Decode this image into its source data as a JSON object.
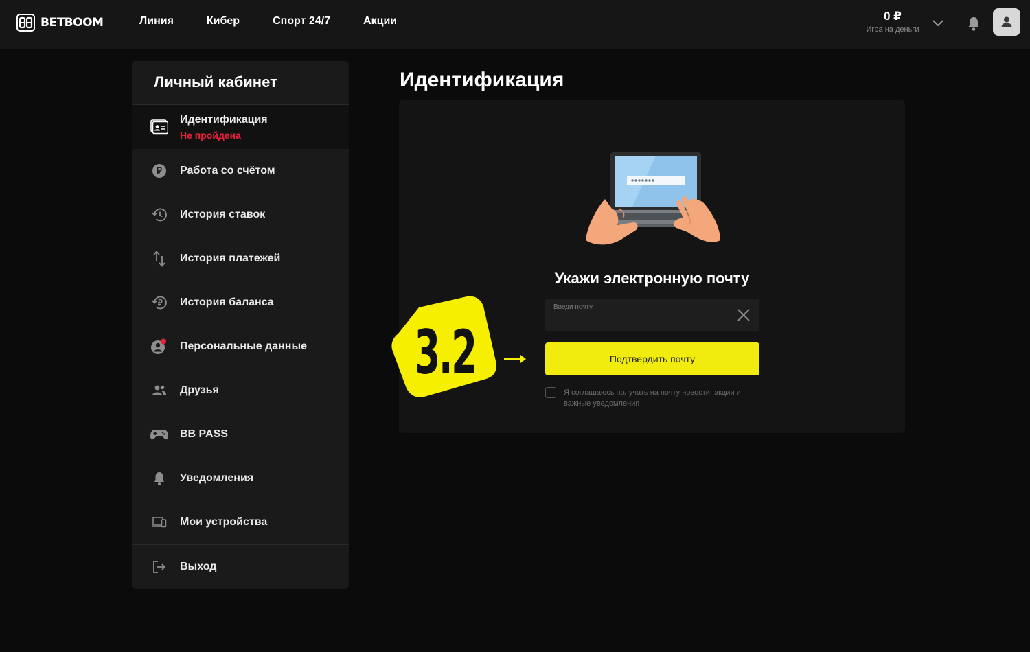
{
  "header": {
    "logo_text": "BETBOOM",
    "nav": [
      "Линия",
      "Кибер",
      "Спорт 24/7",
      "Акции"
    ],
    "balance_amount": "0 ₽",
    "balance_label": "Игра на деньги"
  },
  "sidebar": {
    "title": "Личный кабинет",
    "items": [
      {
        "label": "Идентификация",
        "sub": "Не пройдена",
        "icon": "id-card-icon"
      },
      {
        "label": "Работа со счётом",
        "icon": "ruble-coin-icon"
      },
      {
        "label": "История ставок",
        "icon": "history-icon"
      },
      {
        "label": "История платежей",
        "icon": "transfer-arrows-icon"
      },
      {
        "label": "История баланса",
        "icon": "balance-history-icon"
      },
      {
        "label": "Персональные данные",
        "icon": "user-alert-icon"
      },
      {
        "label": "Друзья",
        "icon": "friends-icon"
      },
      {
        "label": "BB PASS",
        "icon": "gamepad-icon"
      },
      {
        "label": "Уведомления",
        "icon": "bell-icon"
      },
      {
        "label": "Мои устройства",
        "icon": "devices-icon"
      }
    ],
    "logout": {
      "label": "Выход",
      "icon": "logout-icon"
    }
  },
  "main": {
    "title": "Идентификация",
    "heading": "Укажи электронную почту",
    "email_placeholder": "Введи почту",
    "email_value": "",
    "confirm_label": "Подтвердить почту",
    "consent_text": "Я соглашаюсь получать на почту новости, акции и важные уведомления",
    "consent_checked": false
  },
  "overlay": {
    "step_badge": "3.2"
  },
  "colors": {
    "accent_yellow": "#f2ec0e",
    "error_red": "#e8213a",
    "background": "#0b0b0b",
    "panel": "#1a1a1a"
  }
}
